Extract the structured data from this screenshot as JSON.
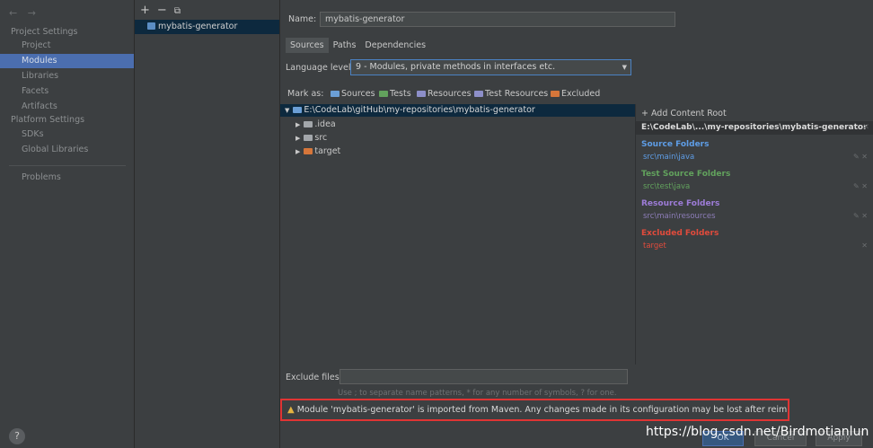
{
  "nav": {
    "arrows": "← →",
    "project_settings": "Project Settings",
    "project": "Project",
    "modules": "Modules",
    "libraries": "Libraries",
    "facets": "Facets",
    "artifacts": "Artifacts",
    "platform_settings": "Platform Settings",
    "sdks": "SDKs",
    "global_libraries": "Global Libraries",
    "problems": "Problems",
    "help": "?"
  },
  "modules_panel": {
    "add": "+",
    "remove": "−",
    "copy": "⧉",
    "item": "mybatis-generator"
  },
  "main": {
    "name_label": "Name:",
    "name_value": "mybatis-generator",
    "tabs": [
      "Sources",
      "Paths",
      "Dependencies"
    ],
    "language_level_label": "Language level:",
    "language_level_value": "9 - Modules, private methods in interfaces etc.",
    "mark_as_label": "Mark as:",
    "mark_sources": "Sources",
    "mark_tests": "Tests",
    "mark_resources": "Resources",
    "mark_test_resources": "Test Resources",
    "mark_excluded": "Excluded",
    "tree": {
      "root": "E:\\CodeLab\\gitHub\\my-repositories\\mybatis-generator",
      "children": [
        ".idea",
        "src",
        "target"
      ]
    },
    "exclude_files_label": "Exclude files:",
    "exclude_files_value": "",
    "exclude_hint": "Use ; to separate name patterns, * for any number of symbols, ? for one.",
    "warning": "Module 'mybatis-generator' is imported from Maven. Any changes made in its configuration may be lost after reimporting."
  },
  "content_roots": {
    "add_label": "+ Add Content Root",
    "root_path": "E:\\CodeLab\\...\\my-repositories\\mybatis-generator",
    "source_title": "Source Folders",
    "source_path": "src\\main\\java",
    "test_title": "Test Source Folders",
    "test_path": "src\\test\\java",
    "resource_title": "Resource Folders",
    "resource_path": "src\\main\\resources",
    "excluded_title": "Excluded Folders",
    "excluded_path": "target"
  },
  "buttons": {
    "ok": "OK",
    "cancel": "Cancel",
    "apply": "Apply"
  },
  "watermark": "https://blog.csdn.net/Birdmotianlun",
  "colors": {
    "source": "#5e9de6",
    "test": "#62a25d",
    "resource": "#9d7cd8",
    "excluded": "#e14b3c",
    "warning_border": "#e03434",
    "selection": "#4b6eaf"
  }
}
